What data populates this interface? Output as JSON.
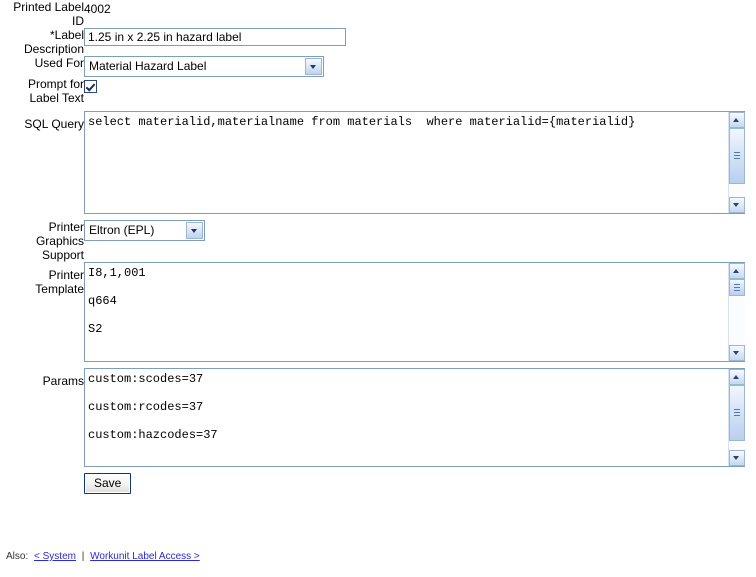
{
  "form": {
    "fields": [
      {
        "label": "Printed Label ID",
        "type": "static",
        "value": "4002"
      },
      {
        "label": "*Label Description",
        "type": "text",
        "value": "1.25 in x 2.25 in hazard label"
      },
      {
        "label": "Used For",
        "type": "select",
        "value": "Material Hazard Label"
      },
      {
        "label": "Prompt for Label Text",
        "type": "checkbox",
        "checked": true
      },
      {
        "label": "SQL Query",
        "type": "textarea",
        "value": "select materialid,materialname from materials  where materialid={materialid}"
      },
      {
        "label": "Printer Graphics Support",
        "type": "select",
        "value": "Eltron (EPL)"
      },
      {
        "label": "Printer Template",
        "type": "textarea",
        "value": "I8,1,001\n\nq664\n\nS2"
      },
      {
        "label": "Params",
        "type": "textarea",
        "value": "custom:scodes=37\n\ncustom:rcodes=37\n\ncustom:hazcodes=37"
      }
    ],
    "labels": {
      "printed_label_id": "Printed Label ID",
      "label_description": "*Label Description",
      "used_for": "Used For",
      "prompt_for_label_text": "Prompt for Label Text",
      "sql_query": "SQL Query",
      "printer_graphics_support": "Printer Graphics Support",
      "printer_template": "Printer Template",
      "params": "Params"
    },
    "values": {
      "printed_label_id": "4002",
      "label_description": "1.25 in x 2.25 in hazard label",
      "used_for": "Material Hazard Label",
      "printer_graphics_support": "Eltron (EPL)",
      "sql_query": "select materialid,materialname from materials  where materialid={materialid}",
      "printer_template": "I8,1,001\n\nq664\n\nS2",
      "params": "custom:scodes=37\n\ncustom:rcodes=37\n\ncustom:hazcodes=37"
    },
    "save_label": "Save"
  },
  "footer": {
    "prefix": "Also:",
    "link_prev": "< System",
    "separator": "|",
    "link_next": "Workunit Label Access >"
  },
  "colors": {
    "field_border": "#7f9db9",
    "link": "#2a2ad6",
    "button_border": "#12347c",
    "scroll_accent": "#b9cfee"
  }
}
